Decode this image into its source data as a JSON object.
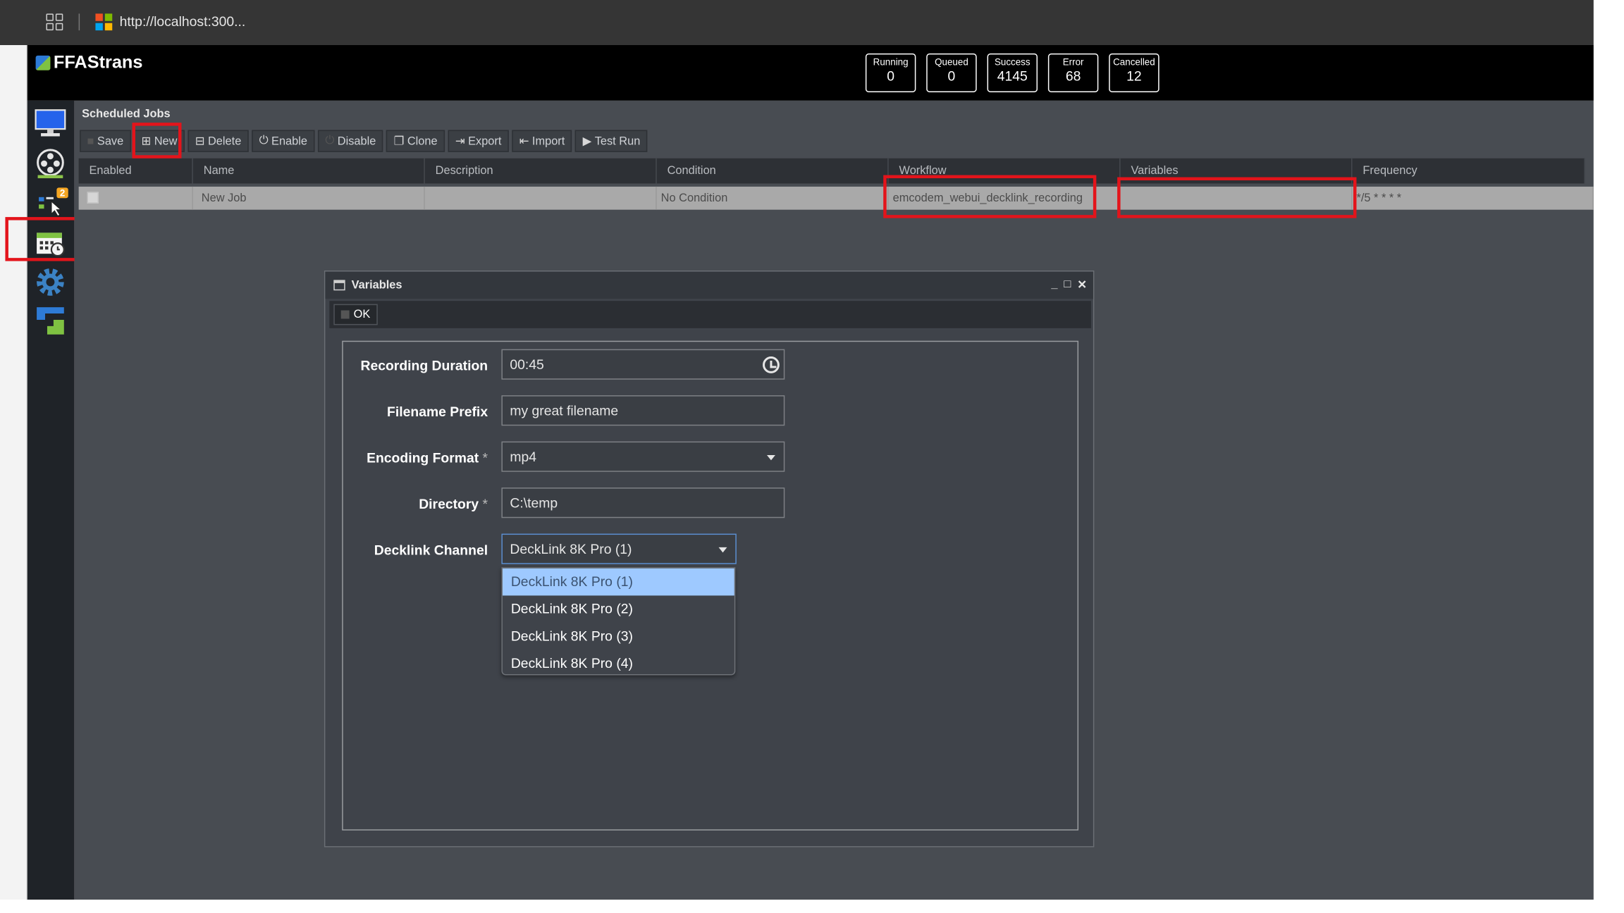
{
  "browser": {
    "url": "http://localhost:300..."
  },
  "app": {
    "title": "FFAStrans",
    "counters": [
      {
        "label": "Running",
        "value": "0"
      },
      {
        "label": "Queued",
        "value": "0"
      },
      {
        "label": "Success",
        "value": "4145"
      },
      {
        "label": "Error",
        "value": "68"
      },
      {
        "label": "Cancelled",
        "value": "12"
      }
    ],
    "sidebar": {
      "items": [
        {
          "icon": "monitor-icon"
        },
        {
          "icon": "film-reel-icon"
        },
        {
          "icon": "jobs-icon",
          "badge": "2"
        },
        {
          "icon": "scheduler-calendar-icon"
        },
        {
          "icon": "gear-icon"
        },
        {
          "icon": "ffastrans-logo-icon"
        }
      ]
    }
  },
  "main": {
    "title": "Scheduled Jobs",
    "toolbar": {
      "save": "Save",
      "new": "New",
      "delete": "Delete",
      "enable": "Enable",
      "disable": "Disable",
      "clone": "Clone",
      "export": "Export",
      "import": "Import",
      "test_run": "Test Run"
    },
    "columns": [
      "Enabled",
      "Name",
      "Description",
      "Condition",
      "Workflow",
      "Variables",
      "Frequency"
    ],
    "rows": [
      {
        "enabled": false,
        "name": "New Job",
        "description": "",
        "condition": "No Condition",
        "workflow": "emcodem_webui_decklink_recording",
        "variables": "",
        "frequency": "*/5 * * * *"
      }
    ]
  },
  "dialog": {
    "title": "Variables",
    "ok_label": "OK",
    "fields": {
      "recording_duration": {
        "label": "Recording Duration",
        "value": "00:45"
      },
      "filename_prefix": {
        "label": "Filename Prefix",
        "value": "my great filename"
      },
      "encoding_format": {
        "label": "Encoding Format",
        "required": "*",
        "value": "mp4"
      },
      "directory": {
        "label": "Directory",
        "required": "*",
        "value": "C:\\temp"
      },
      "decklink_channel": {
        "label": "Decklink Channel",
        "value": "DeckLink 8K Pro (1)",
        "options": [
          "DeckLink 8K Pro (1)",
          "DeckLink 8K Pro (2)",
          "DeckLink 8K Pro (3)",
          "DeckLink 8K Pro (4)"
        ]
      }
    }
  },
  "colors": {
    "highlight": "#e3141b",
    "selected_option": "#9ec9ff",
    "header_bg": "#000000",
    "panel_bg": "#484c52"
  }
}
